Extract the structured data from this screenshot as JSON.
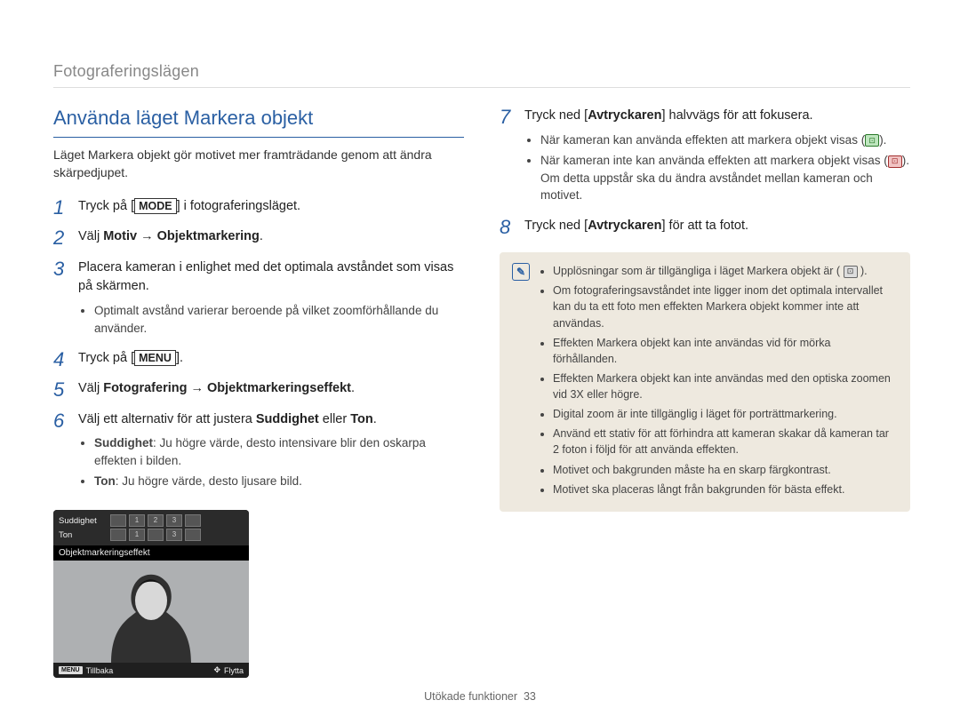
{
  "section_label": "Fotograferingslägen",
  "heading": "Använda läget Markera objekt",
  "intro": "Läget Markera objekt gör motivet mer framträdande genom att ändra skärpedjupet.",
  "left_steps": [
    {
      "num": "1",
      "html_parts": [
        "Tryck på [",
        {
          "boxed": "MODE"
        },
        "] i fotograferingsläget."
      ]
    },
    {
      "num": "2",
      "html_parts": [
        "Välj ",
        {
          "bold": "Motiv → Objektmarkering"
        },
        "."
      ]
    },
    {
      "num": "3",
      "html_parts": [
        "Placera kameran i enlighet med det optimala avståndet som visas på skärmen."
      ],
      "sub": [
        "Optimalt avstånd varierar beroende på vilket zoomförhållande du använder."
      ]
    },
    {
      "num": "4",
      "html_parts": [
        "Tryck på [",
        {
          "boxed": "MENU"
        },
        "]."
      ]
    },
    {
      "num": "5",
      "html_parts": [
        "Välj ",
        {
          "bold": "Fotografering → Objektmarkeringseffekt"
        },
        "."
      ]
    },
    {
      "num": "6",
      "html_parts": [
        "Välj ett alternativ för att justera ",
        {
          "bold": "Suddighet"
        },
        " eller ",
        {
          "bold": "Ton"
        },
        "."
      ],
      "sub_rich": [
        [
          {
            "bold": "Suddighet"
          },
          ": Ju högre värde, desto intensivare blir den oskarpa effekten i bilden."
        ],
        [
          {
            "bold": "Ton"
          },
          ": Ju högre värde, desto ljusare bild."
        ]
      ]
    }
  ],
  "camera": {
    "row1_label": "Suddighet",
    "row2_label": "Ton",
    "thumbs1": [
      "",
      "1",
      "2",
      "3",
      ""
    ],
    "thumbs2": [
      "",
      "1",
      "",
      "3",
      ""
    ],
    "banner": "Objektmarkeringseffekt",
    "back_label": "Tillbaka",
    "move_label": "Flytta",
    "menu_chip": "MENU"
  },
  "right_steps": [
    {
      "num": "7",
      "html_parts": [
        "Tryck ned [",
        {
          "bold": "Avtryckaren"
        },
        "] halvvägs för att fokusera."
      ],
      "sub_rich": [
        [
          "När kameran kan använda effekten att markera objekt visas (",
          {
            "icon": "green"
          },
          ")."
        ],
        [
          "När kameran inte kan använda effekten att markera objekt visas (",
          {
            "icon": "red"
          },
          "). Om detta uppstår ska du ändra avståndet mellan kameran och motivet."
        ]
      ]
    },
    {
      "num": "8",
      "html_parts": [
        "Tryck ned [",
        {
          "bold": "Avtryckaren"
        },
        "] för att ta fotot."
      ]
    }
  ],
  "note": {
    "items_rich": [
      [
        "Upplösningar som är tillgängliga i läget Markera objekt är ( ",
        {
          "icon": "grey"
        },
        " )."
      ],
      [
        "Om fotograferingsavståndet inte ligger inom det optimala intervallet kan du ta ett foto men effekten Markera objekt kommer inte att användas."
      ],
      [
        "Effekten Markera objekt kan inte användas vid för mörka förhållanden."
      ],
      [
        "Effekten Markera objekt kan inte användas med den optiska zoomen vid 3X eller högre."
      ],
      [
        "Digital zoom är inte tillgänglig i läget för porträttmarkering."
      ],
      [
        "Använd ett stativ för att förhindra att kameran skakar då kameran tar 2 foton i följd för att använda effekten."
      ],
      [
        "Motivet och bakgrunden måste ha en skarp färgkontrast."
      ],
      [
        "Motivet ska placeras långt från bakgrunden för bästa effekt."
      ]
    ]
  },
  "footer": {
    "label": "Utökade funktioner",
    "page": "33"
  }
}
